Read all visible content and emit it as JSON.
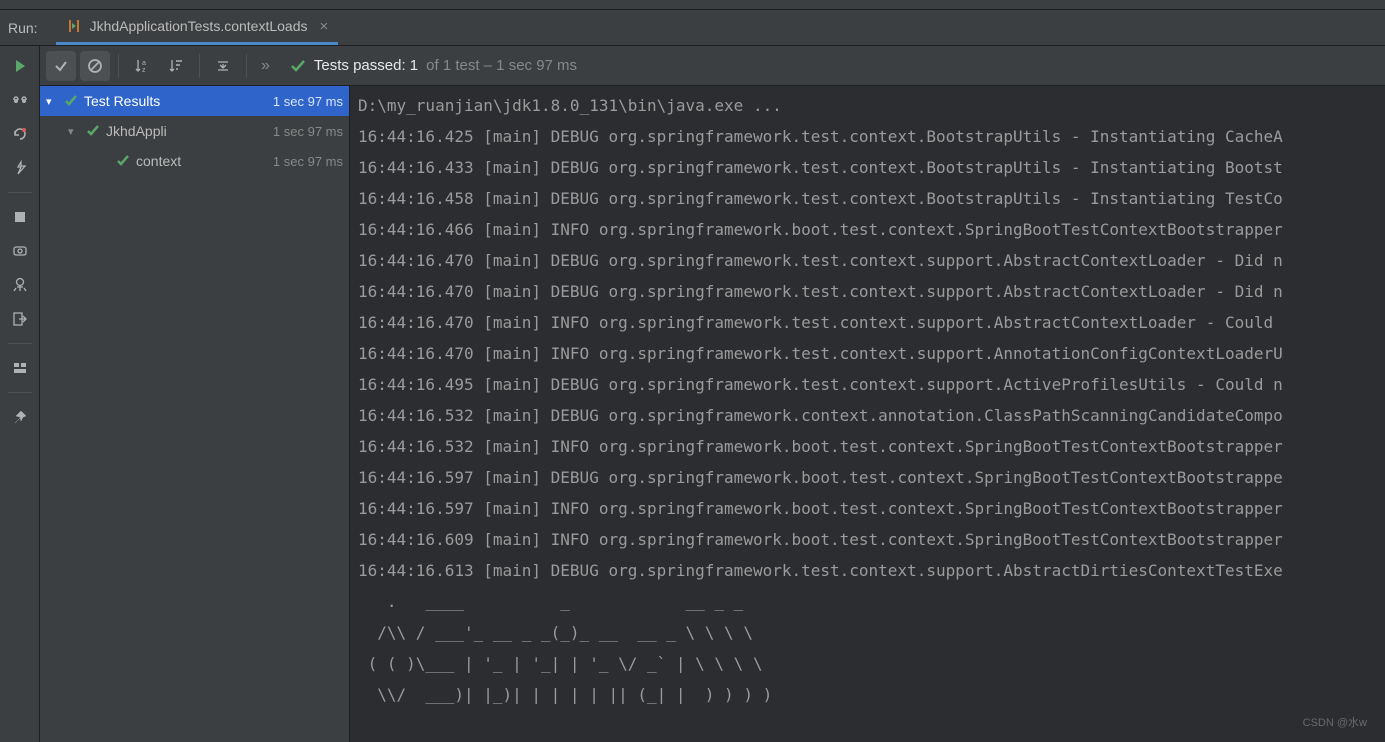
{
  "header": {
    "run_label": "Run:",
    "tab_name": "JkhdApplicationTests.contextLoads"
  },
  "toolbar": {
    "status_prefix": "Tests passed: 1",
    "status_suffix": " of 1 test – 1 sec 97 ms"
  },
  "tree": {
    "root": {
      "label": "Test Results",
      "time": "1 sec 97 ms"
    },
    "level1": {
      "label": "JkhdAppli",
      "time": "1 sec 97 ms"
    },
    "level2": {
      "label": "context",
      "time": "1 sec 97 ms"
    }
  },
  "console": {
    "line0": "D:\\my_ruanjian\\jdk1.8.0_131\\bin\\java.exe ...",
    "line1": "16:44:16.425 [main] DEBUG org.springframework.test.context.BootstrapUtils - Instantiating CacheA",
    "line2": "16:44:16.433 [main] DEBUG org.springframework.test.context.BootstrapUtils - Instantiating Bootst",
    "line3": "16:44:16.458 [main] DEBUG org.springframework.test.context.BootstrapUtils - Instantiating TestCo",
    "line4": "16:44:16.466 [main] INFO org.springframework.boot.test.context.SpringBootTestContextBootstrapper",
    "line5": "16:44:16.470 [main] DEBUG org.springframework.test.context.support.AbstractContextLoader - Did n",
    "line6": "16:44:16.470 [main] DEBUG org.springframework.test.context.support.AbstractContextLoader - Did n",
    "line7": "16:44:16.470 [main] INFO org.springframework.test.context.support.AbstractContextLoader - Could ",
    "line8": "16:44:16.470 [main] INFO org.springframework.test.context.support.AnnotationConfigContextLoaderU",
    "line9": "16:44:16.495 [main] DEBUG org.springframework.test.context.support.ActiveProfilesUtils - Could n",
    "line10": "16:44:16.532 [main] DEBUG org.springframework.context.annotation.ClassPathScanningCandidateCompo",
    "line11": "16:44:16.532 [main] INFO org.springframework.boot.test.context.SpringBootTestContextBootstrapper",
    "line12": "16:44:16.597 [main] DEBUG org.springframework.boot.test.context.SpringBootTestContextBootstrappe",
    "line13": "16:44:16.597 [main] INFO org.springframework.boot.test.context.SpringBootTestContextBootstrapper",
    "line14": "16:44:16.609 [main] INFO org.springframework.boot.test.context.SpringBootTestContextBootstrapper",
    "line15": "16:44:16.613 [main] DEBUG org.springframework.test.context.support.AbstractDirtiesContextTestExe",
    "line16": "",
    "line17": "   .   ____          _            __ _ _",
    "line18": "  /\\\\ / ___'_ __ _ _(_)_ __  __ _ \\ \\ \\ \\",
    "line19": " ( ( )\\___ | '_ | '_| | '_ \\/ _` | \\ \\ \\ \\",
    "line20": "  \\\\/  ___)| |_)| | | | | || (_| |  ) ) ) )"
  },
  "watermark": "CSDN @水w"
}
